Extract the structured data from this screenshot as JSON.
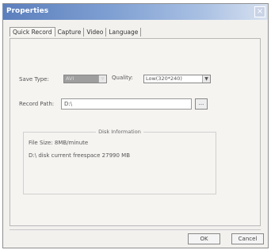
{
  "window": {
    "title": "Properties",
    "close_glyph": "×"
  },
  "tabs": [
    {
      "label": "Quick Record",
      "active": true
    },
    {
      "label": "Capture",
      "active": false
    },
    {
      "label": "Video",
      "active": false
    },
    {
      "label": "Language",
      "active": false
    }
  ],
  "form": {
    "save_type_label": "Save Type:",
    "save_type_value": "AVI",
    "quality_label": "Quality:",
    "quality_value": "Low(320*240)",
    "record_path_label": "Record Path:",
    "record_path_value": "D:\\",
    "browse_label": "..."
  },
  "disk_info": {
    "title": "Disk Information",
    "file_size": "File Size: 8MB/minute",
    "free_space": "D:\\ disk current freespace 27990 MB"
  },
  "buttons": {
    "ok": "OK",
    "cancel": "Cancel"
  }
}
